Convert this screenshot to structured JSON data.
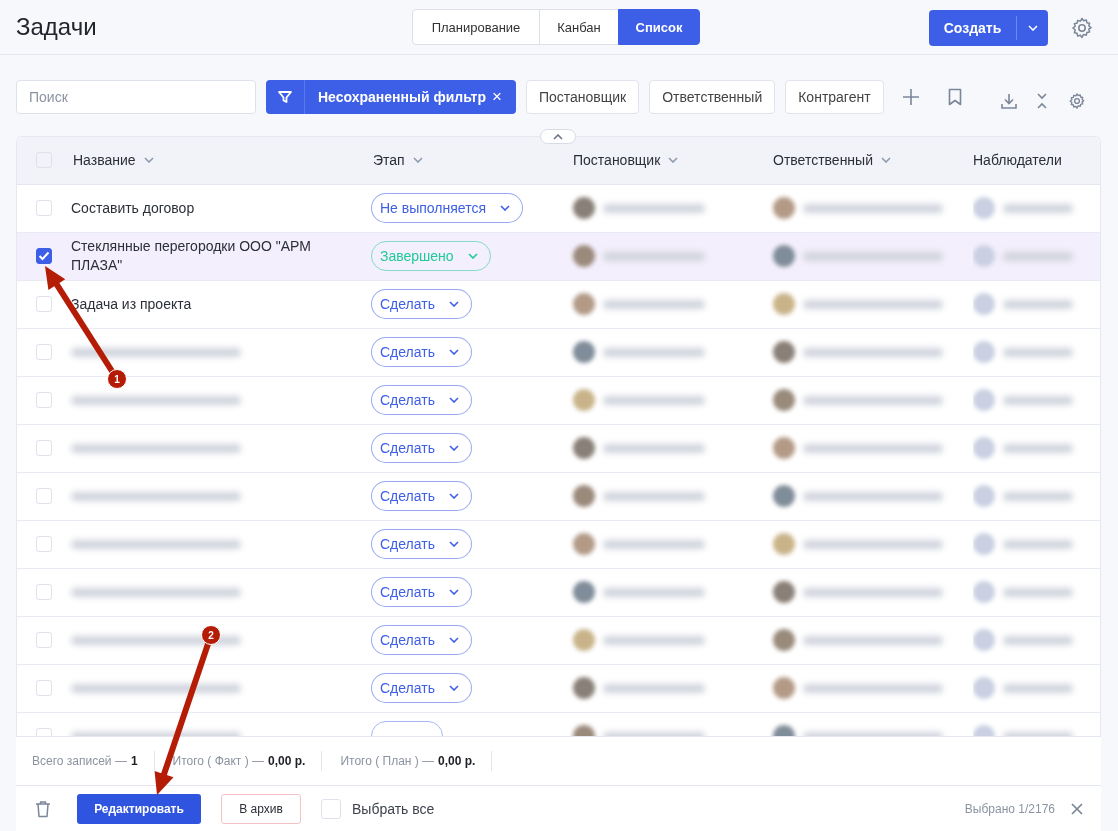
{
  "title": "Задачи",
  "view_tabs": [
    {
      "label": "Планирование",
      "selected": false
    },
    {
      "label": "Канбан",
      "selected": false
    },
    {
      "label": "Список",
      "selected": true
    }
  ],
  "create_button": "Создать",
  "search": {
    "placeholder": "Поиск"
  },
  "filter": {
    "label": "Несохраненный фильтр",
    "close": "×"
  },
  "filter_chips": [
    "Постановщик",
    "Ответственный",
    "Контрагент"
  ],
  "table": {
    "columns": [
      {
        "label": "Название",
        "sortable": true
      },
      {
        "label": "Этап",
        "sortable": true
      },
      {
        "label": "Постановщик",
        "sortable": true
      },
      {
        "label": "Ответственный",
        "sortable": true
      },
      {
        "label": "Наблюдатели",
        "sortable": false
      }
    ],
    "rows": [
      {
        "name": "Составить договор",
        "checked": false,
        "stage": "Не выполняется",
        "color": "#3d5ee6"
      },
      {
        "name": "Стеклянные перегородки ООО \"АРМ ПЛАЗА\"",
        "checked": true,
        "stage": "Завершено",
        "color": "#1fc99a"
      },
      {
        "name": "Задача из проекта",
        "checked": false,
        "stage": "Сделать",
        "color": "#3d5ee6"
      },
      {
        "checked": false,
        "stage": "Сделать",
        "color": "#3d5ee6"
      },
      {
        "checked": false,
        "stage": "Сделать",
        "color": "#3d5ee6"
      },
      {
        "checked": false,
        "stage": "Сделать",
        "color": "#3d5ee6"
      },
      {
        "checked": false,
        "stage": "Сделать",
        "color": "#3d5ee6"
      },
      {
        "checked": false,
        "stage": "Сделать",
        "color": "#3d5ee6"
      },
      {
        "checked": false,
        "stage": "Сделать",
        "color": "#3d5ee6"
      },
      {
        "checked": false,
        "stage": "Сделать",
        "color": "#3d5ee6"
      },
      {
        "checked": false,
        "stage": "Сделать",
        "color": "#3d5ee6"
      },
      {
        "checked": false
      }
    ],
    "all_checked": false,
    "collapse_toggle": {
      "expanded": true
    }
  },
  "totals": [
    {
      "label": "Всего записей —",
      "value": "1"
    },
    {
      "label": "Итого ( Факт ) —",
      "value": "0,00 р."
    },
    {
      "label": "Итого ( План ) —",
      "value": "0,00 р."
    }
  ],
  "actions": {
    "edit": "Редактировать",
    "archive": "В архив",
    "select_all": {
      "label": "Выбрать все",
      "checked": false
    },
    "selected_count": "Выбрано 1/2176"
  },
  "annotations": [
    {
      "number": "1"
    },
    {
      "number": "2"
    }
  ]
}
